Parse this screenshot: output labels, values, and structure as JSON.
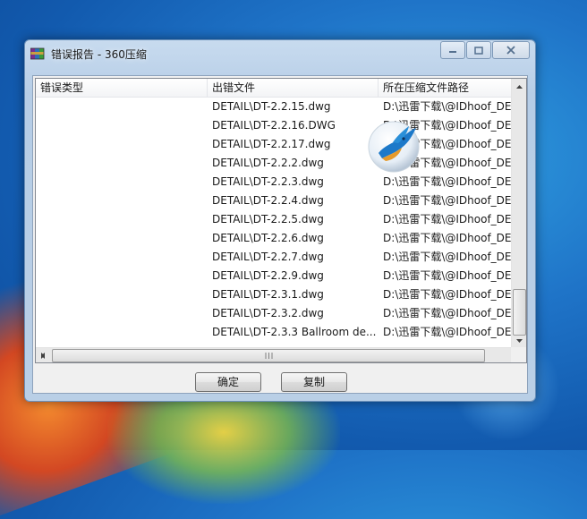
{
  "window": {
    "title": "错误报告 - 360压缩",
    "icon": "rar-archive-icon",
    "controls": [
      "minimize-icon",
      "maximize-icon",
      "close-icon"
    ]
  },
  "list": {
    "columns": [
      "错误类型",
      "出错文件",
      "所在压缩文件路径"
    ],
    "rows": [
      {
        "type": "",
        "file": "DETAIL\\DT-2.2.15.dwg",
        "path": "D:\\迅雷下载\\@IDhoof_DE"
      },
      {
        "type": "",
        "file": "DETAIL\\DT-2.2.16.DWG",
        "path": "D:\\迅雷下载\\@IDhoof_DE"
      },
      {
        "type": "",
        "file": "DETAIL\\DT-2.2.17.dwg",
        "path": "D:\\迅雷下载\\@IDhoof_DE"
      },
      {
        "type": "",
        "file": "DETAIL\\DT-2.2.2.dwg",
        "path": "D:\\迅雷下载\\@IDhoof_DE"
      },
      {
        "type": "",
        "file": "DETAIL\\DT-2.2.3.dwg",
        "path": "D:\\迅雷下载\\@IDhoof_DE"
      },
      {
        "type": "",
        "file": "DETAIL\\DT-2.2.4.dwg",
        "path": "D:\\迅雷下载\\@IDhoof_DE"
      },
      {
        "type": "",
        "file": "DETAIL\\DT-2.2.5.dwg",
        "path": "D:\\迅雷下载\\@IDhoof_DE"
      },
      {
        "type": "",
        "file": "DETAIL\\DT-2.2.6.dwg",
        "path": "D:\\迅雷下载\\@IDhoof_DE"
      },
      {
        "type": "",
        "file": "DETAIL\\DT-2.2.7.dwg",
        "path": "D:\\迅雷下载\\@IDhoof_DE"
      },
      {
        "type": "",
        "file": "DETAIL\\DT-2.2.9.dwg",
        "path": "D:\\迅雷下载\\@IDhoof_DE"
      },
      {
        "type": "",
        "file": "DETAIL\\DT-2.3.1.dwg",
        "path": "D:\\迅雷下载\\@IDhoof_DE"
      },
      {
        "type": "",
        "file": "DETAIL\\DT-2.3.2.dwg",
        "path": "D:\\迅雷下载\\@IDhoof_DE"
      },
      {
        "type": "",
        "file": "DETAIL\\DT-2.3.3 Ballroom de...",
        "path": "D:\\迅雷下载\\@IDhoof_DE"
      }
    ]
  },
  "buttons": {
    "ok": "确定",
    "copy": "复制"
  },
  "overlay": {
    "icon": "bird-logo-icon"
  },
  "colors": {
    "desktop": "#1f74c8",
    "window_frame": "#b9cfe6"
  }
}
